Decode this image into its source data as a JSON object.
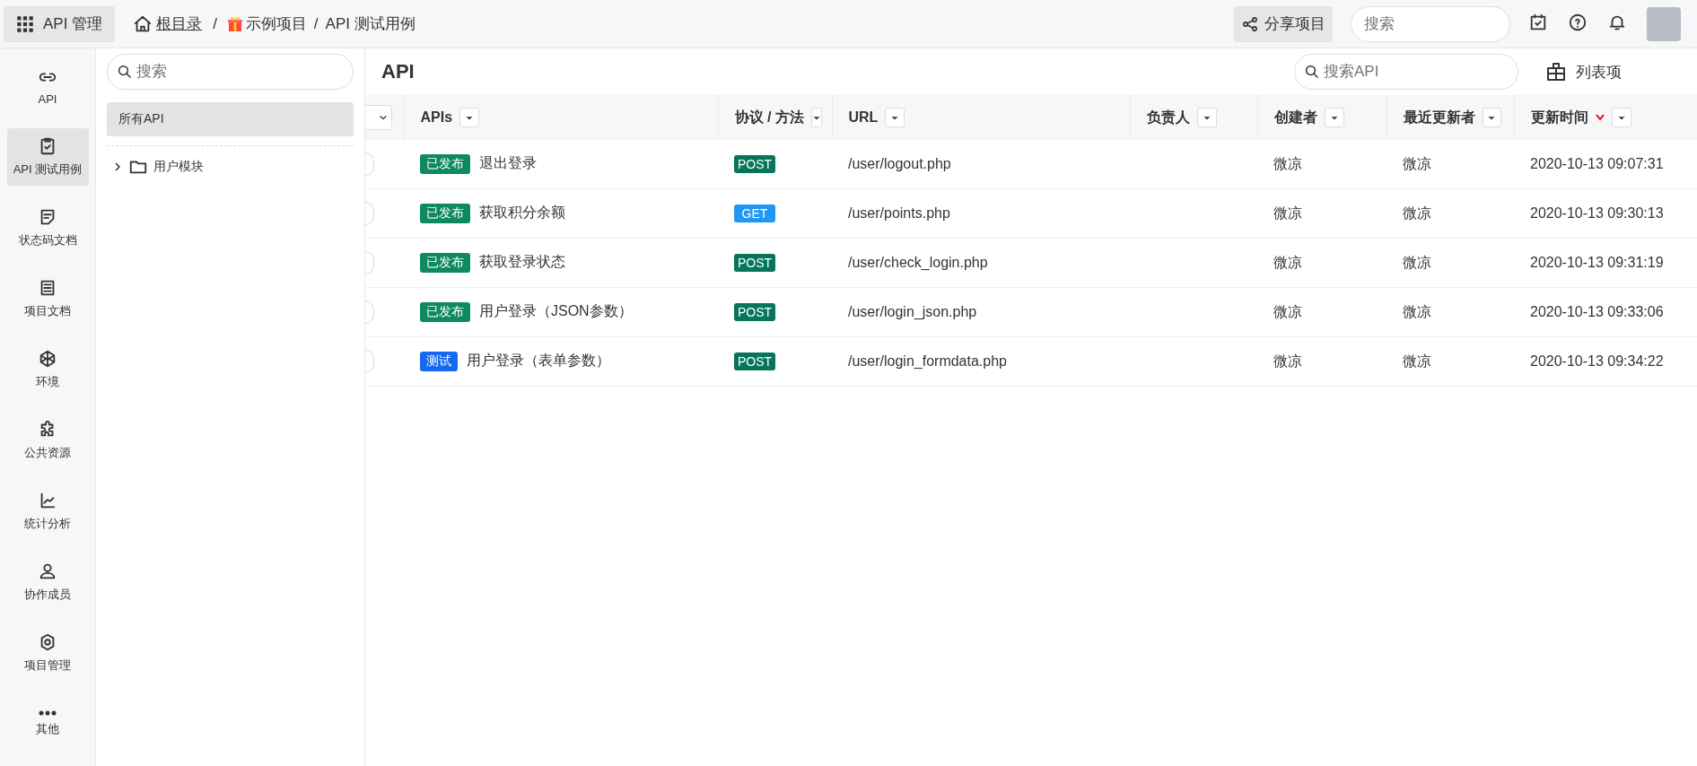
{
  "topbar": {
    "app_button": "API 管理",
    "breadcrumb": [
      {
        "label": "根目录",
        "kind": "home"
      },
      {
        "label": "示例项目",
        "kind": "gift"
      },
      {
        "label": "API 测试用例",
        "kind": "plain"
      }
    ],
    "separator": "/",
    "share_button": "分享项目",
    "search": {
      "placeholder": "搜索"
    }
  },
  "nav": [
    {
      "label": "API",
      "kind": "link",
      "selected": false
    },
    {
      "label": "API 测试用例",
      "kind": "clipboard",
      "selected": true
    },
    {
      "label": "状态码文档",
      "kind": "note",
      "selected": false
    },
    {
      "label": "项目文档",
      "kind": "doc",
      "selected": false
    },
    {
      "label": "环境",
      "kind": "cube",
      "selected": false
    },
    {
      "label": "公共资源",
      "kind": "puzzle",
      "selected": false
    },
    {
      "label": "统计分析",
      "kind": "chart",
      "selected": false
    },
    {
      "label": "协作成员",
      "kind": "user",
      "selected": false
    },
    {
      "label": "项目管理",
      "kind": "gear",
      "selected": false
    },
    {
      "label": "其他",
      "kind": "dots",
      "selected": false
    }
  ],
  "tree": {
    "search": {
      "placeholder": "搜索"
    },
    "all_item": {
      "label": "所有API",
      "selected": true
    },
    "folders": [
      {
        "label": "用户模块",
        "expanded": false
      }
    ]
  },
  "main": {
    "title": "API",
    "search": {
      "placeholder": "搜索API"
    },
    "columns_button": "列表项"
  },
  "table": {
    "columns": [
      {
        "label": "APIs",
        "sorted": false
      },
      {
        "label": "协议 / 方法",
        "sorted": false
      },
      {
        "label": "URL",
        "sorted": false
      },
      {
        "label": "负责人",
        "sorted": false
      },
      {
        "label": "创建者",
        "sorted": false
      },
      {
        "label": "最近更新者",
        "sorted": false
      },
      {
        "label": "更新时间",
        "sorted": true
      }
    ],
    "rows": [
      {
        "status": {
          "label": "已发布",
          "color": "#0f8a5f"
        },
        "name": "退出登录",
        "method": {
          "label": "POST",
          "color": "#07755a"
        },
        "url": "/user/logout.php",
        "checked": false,
        "creator": "微凉",
        "updater": "微凉",
        "updated": "2020-10-13 09:07:31"
      },
      {
        "status": {
          "label": "已发布",
          "color": "#0f8a5f"
        },
        "name": "获取积分余额",
        "method": {
          "label": "GET",
          "color": "#2196f3"
        },
        "url": "/user/points.php",
        "checked": false,
        "creator": "微凉",
        "updater": "微凉",
        "updated": "2020-10-13 09:30:13"
      },
      {
        "status": {
          "label": "已发布",
          "color": "#0f8a5f"
        },
        "name": "获取登录状态",
        "method": {
          "label": "POST",
          "color": "#07755a"
        },
        "url": "/user/check_login.php",
        "checked": false,
        "creator": "微凉",
        "updater": "微凉",
        "updated": "2020-10-13 09:31:19"
      },
      {
        "status": {
          "label": "已发布",
          "color": "#0f8a5f"
        },
        "name": "用户登录（JSON参数）",
        "method": {
          "label": "POST",
          "color": "#07755a"
        },
        "url": "/user/login_json.php",
        "checked": false,
        "creator": "微凉",
        "updater": "微凉",
        "updated": "2020-10-13 09:33:06"
      },
      {
        "status": {
          "label": "测试",
          "color": "#1668f0"
        },
        "name": "用户登录（表单参数）",
        "method": {
          "label": "POST",
          "color": "#07755a"
        },
        "url": "/user/login_formdata.php",
        "checked": false,
        "creator": "微凉",
        "updater": "微凉",
        "updated": "2020-10-13 09:34:22"
      }
    ]
  }
}
